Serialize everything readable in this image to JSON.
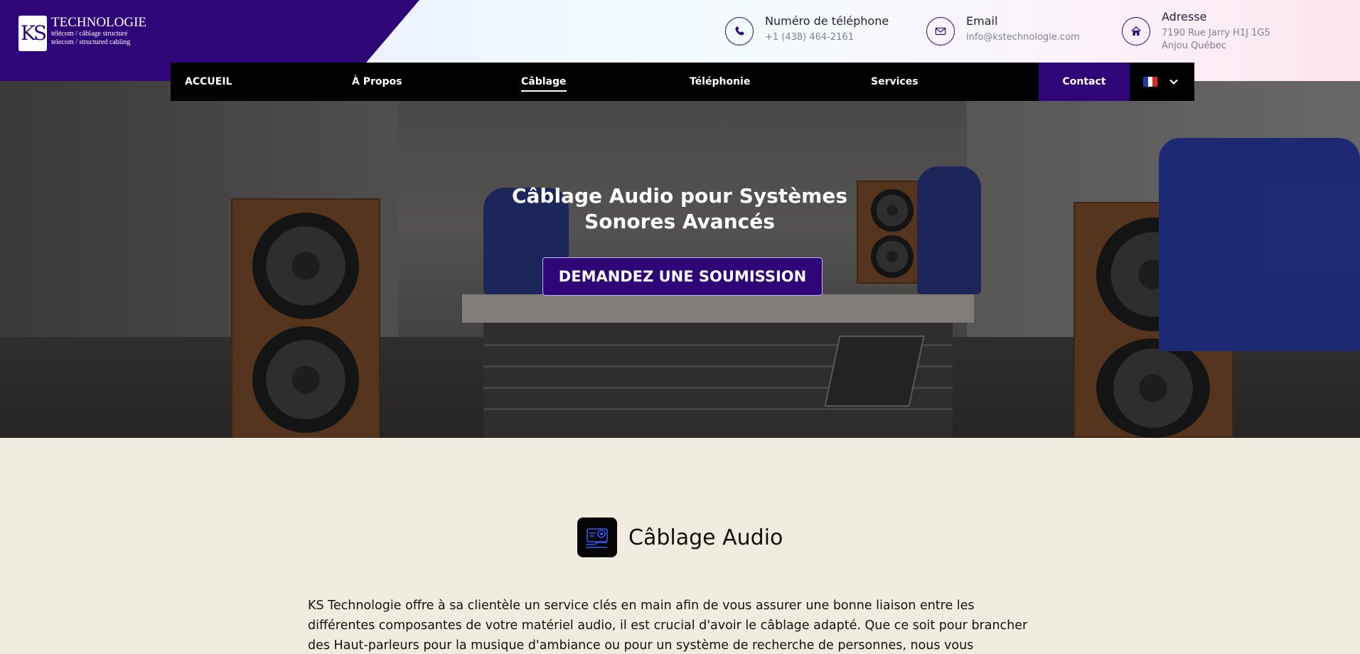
{
  "logo": {
    "mark": "KS",
    "title": "TECHNOLOGIE",
    "subtitle1": "télécom / câblage structuré",
    "subtitle2": "telecom / structured cabling"
  },
  "contacts": {
    "phone": {
      "label": "Numéro de téléphone",
      "value": "+1 (438) 464-2161",
      "icon": "phone-icon"
    },
    "email": {
      "label": "Email",
      "value": "info@kstechnologie.com",
      "icon": "envelope-icon"
    },
    "address": {
      "label": "Adresse",
      "line1": "7190 Rue Jarry H1J 1G5",
      "line2": "Anjou Québec",
      "icon": "home-icon"
    }
  },
  "nav": {
    "items": [
      "ACCUEIL",
      "À Propos",
      "Câblage",
      "Téléphonie",
      "Services"
    ],
    "active": "Câblage",
    "contact": "Contact",
    "language": "FR"
  },
  "hero": {
    "title_line1": "Câblage Audio pour Systèmes",
    "title_line2": "Sonores Avancés",
    "cta": "DEMANDEZ UNE SOUMISSION"
  },
  "section": {
    "title": "Câblage Audio",
    "icon": "audio-setup-icon",
    "body_line1": "KS Technologie offre à sa clientèle un service clés en main afin de vous assurer une bonne liaison entre les",
    "body_line2": "différentes composantes de votre matériel audio, il est crucial d'avoir le câblage adapté. Que ce soit pour brancher",
    "body_line3": "des Haut-parleurs pour la musique d'ambiance ou pour un système de recherche de personnes, nous vous"
  },
  "colors": {
    "brand": "#2e0677",
    "nav_bg": "#000000",
    "page_bg": "#f0ece0"
  }
}
